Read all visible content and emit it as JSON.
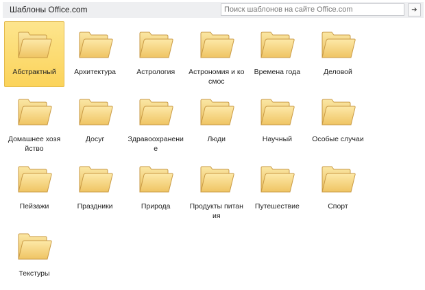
{
  "header": {
    "title": "Шаблоны Office.com",
    "search_placeholder": "Поиск шаблонов на сайте Office.com",
    "go_icon": "arrow-right-icon"
  },
  "folders": [
    {
      "label": "Абстрактный",
      "selected": true
    },
    {
      "label": "Архитектура"
    },
    {
      "label": "Астрология"
    },
    {
      "label": "Астрономия и космос"
    },
    {
      "label": "Времена года"
    },
    {
      "label": "Деловой"
    },
    {
      "label": "Домашнее хозяйство"
    },
    {
      "label": "Досуг"
    },
    {
      "label": "Здравоохранение"
    },
    {
      "label": "Люди"
    },
    {
      "label": "Научный"
    },
    {
      "label": "Особые случаи"
    },
    {
      "label": "Пейзажи"
    },
    {
      "label": "Праздники"
    },
    {
      "label": "Природа"
    },
    {
      "label": "Продукты питания"
    },
    {
      "label": "Путешествие"
    },
    {
      "label": "Спорт"
    },
    {
      "label": "Текстуры"
    }
  ]
}
